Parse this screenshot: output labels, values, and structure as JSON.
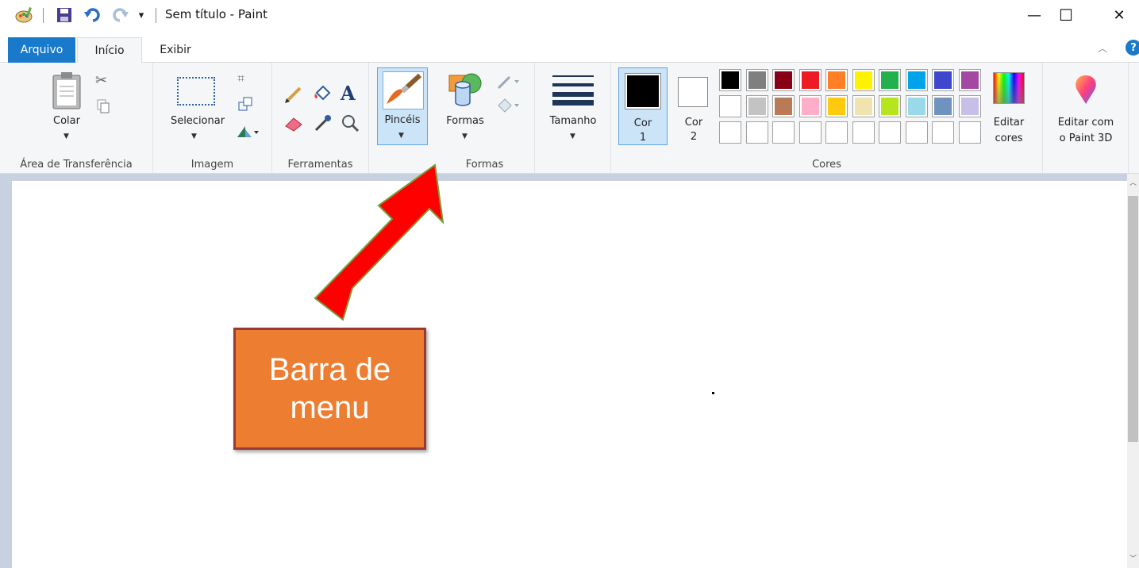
{
  "window": {
    "title": "Sem título - Paint",
    "minimize_glyph": "—",
    "maximize_glyph": "☐",
    "close_glyph": "✕"
  },
  "quick_access": {
    "customize_glyph": "▾"
  },
  "tabs": {
    "file": "Arquivo",
    "home": "Início",
    "view": "Exibir"
  },
  "ribbon": {
    "clipboard": {
      "paste_label": "Colar",
      "group_label": "Área de Transferência"
    },
    "image": {
      "select_label": "Selecionar",
      "group_label": "Imagem"
    },
    "tools": {
      "group_label": "Ferramentas"
    },
    "brushes": {
      "label": "Pincéis"
    },
    "shapes": {
      "label": "Formas",
      "group_label": "Formas"
    },
    "size": {
      "label": "Tamanho"
    },
    "colors": {
      "color1_label": "Cor",
      "color1_num": "1",
      "color2_label": "Cor",
      "color2_num": "2",
      "edit_colors_line1": "Editar",
      "edit_colors_line2": "cores",
      "group_label": "Cores",
      "palette_row1": [
        "#000000",
        "#7f7f7f",
        "#880015",
        "#ed1c24",
        "#ff7f27",
        "#fff200",
        "#22b14c",
        "#00a2e8",
        "#3f48cc",
        "#a349a4"
      ],
      "palette_row2": [
        "#ffffff",
        "#c3c3c3",
        "#b97a57",
        "#ffaec9",
        "#ffc90e",
        "#efe4b0",
        "#b5e61d",
        "#99d9ea",
        "#7092be",
        "#c8bfe7"
      ],
      "color1_value": "#000000",
      "color2_value": "#ffffff"
    },
    "paint3d": {
      "line1": "Editar com",
      "line2": "o Paint 3D"
    }
  },
  "annotation": {
    "line1": "Barra de",
    "line2": "menu",
    "fill": "#ed7d31",
    "arrow_fill": "#ff0000"
  }
}
